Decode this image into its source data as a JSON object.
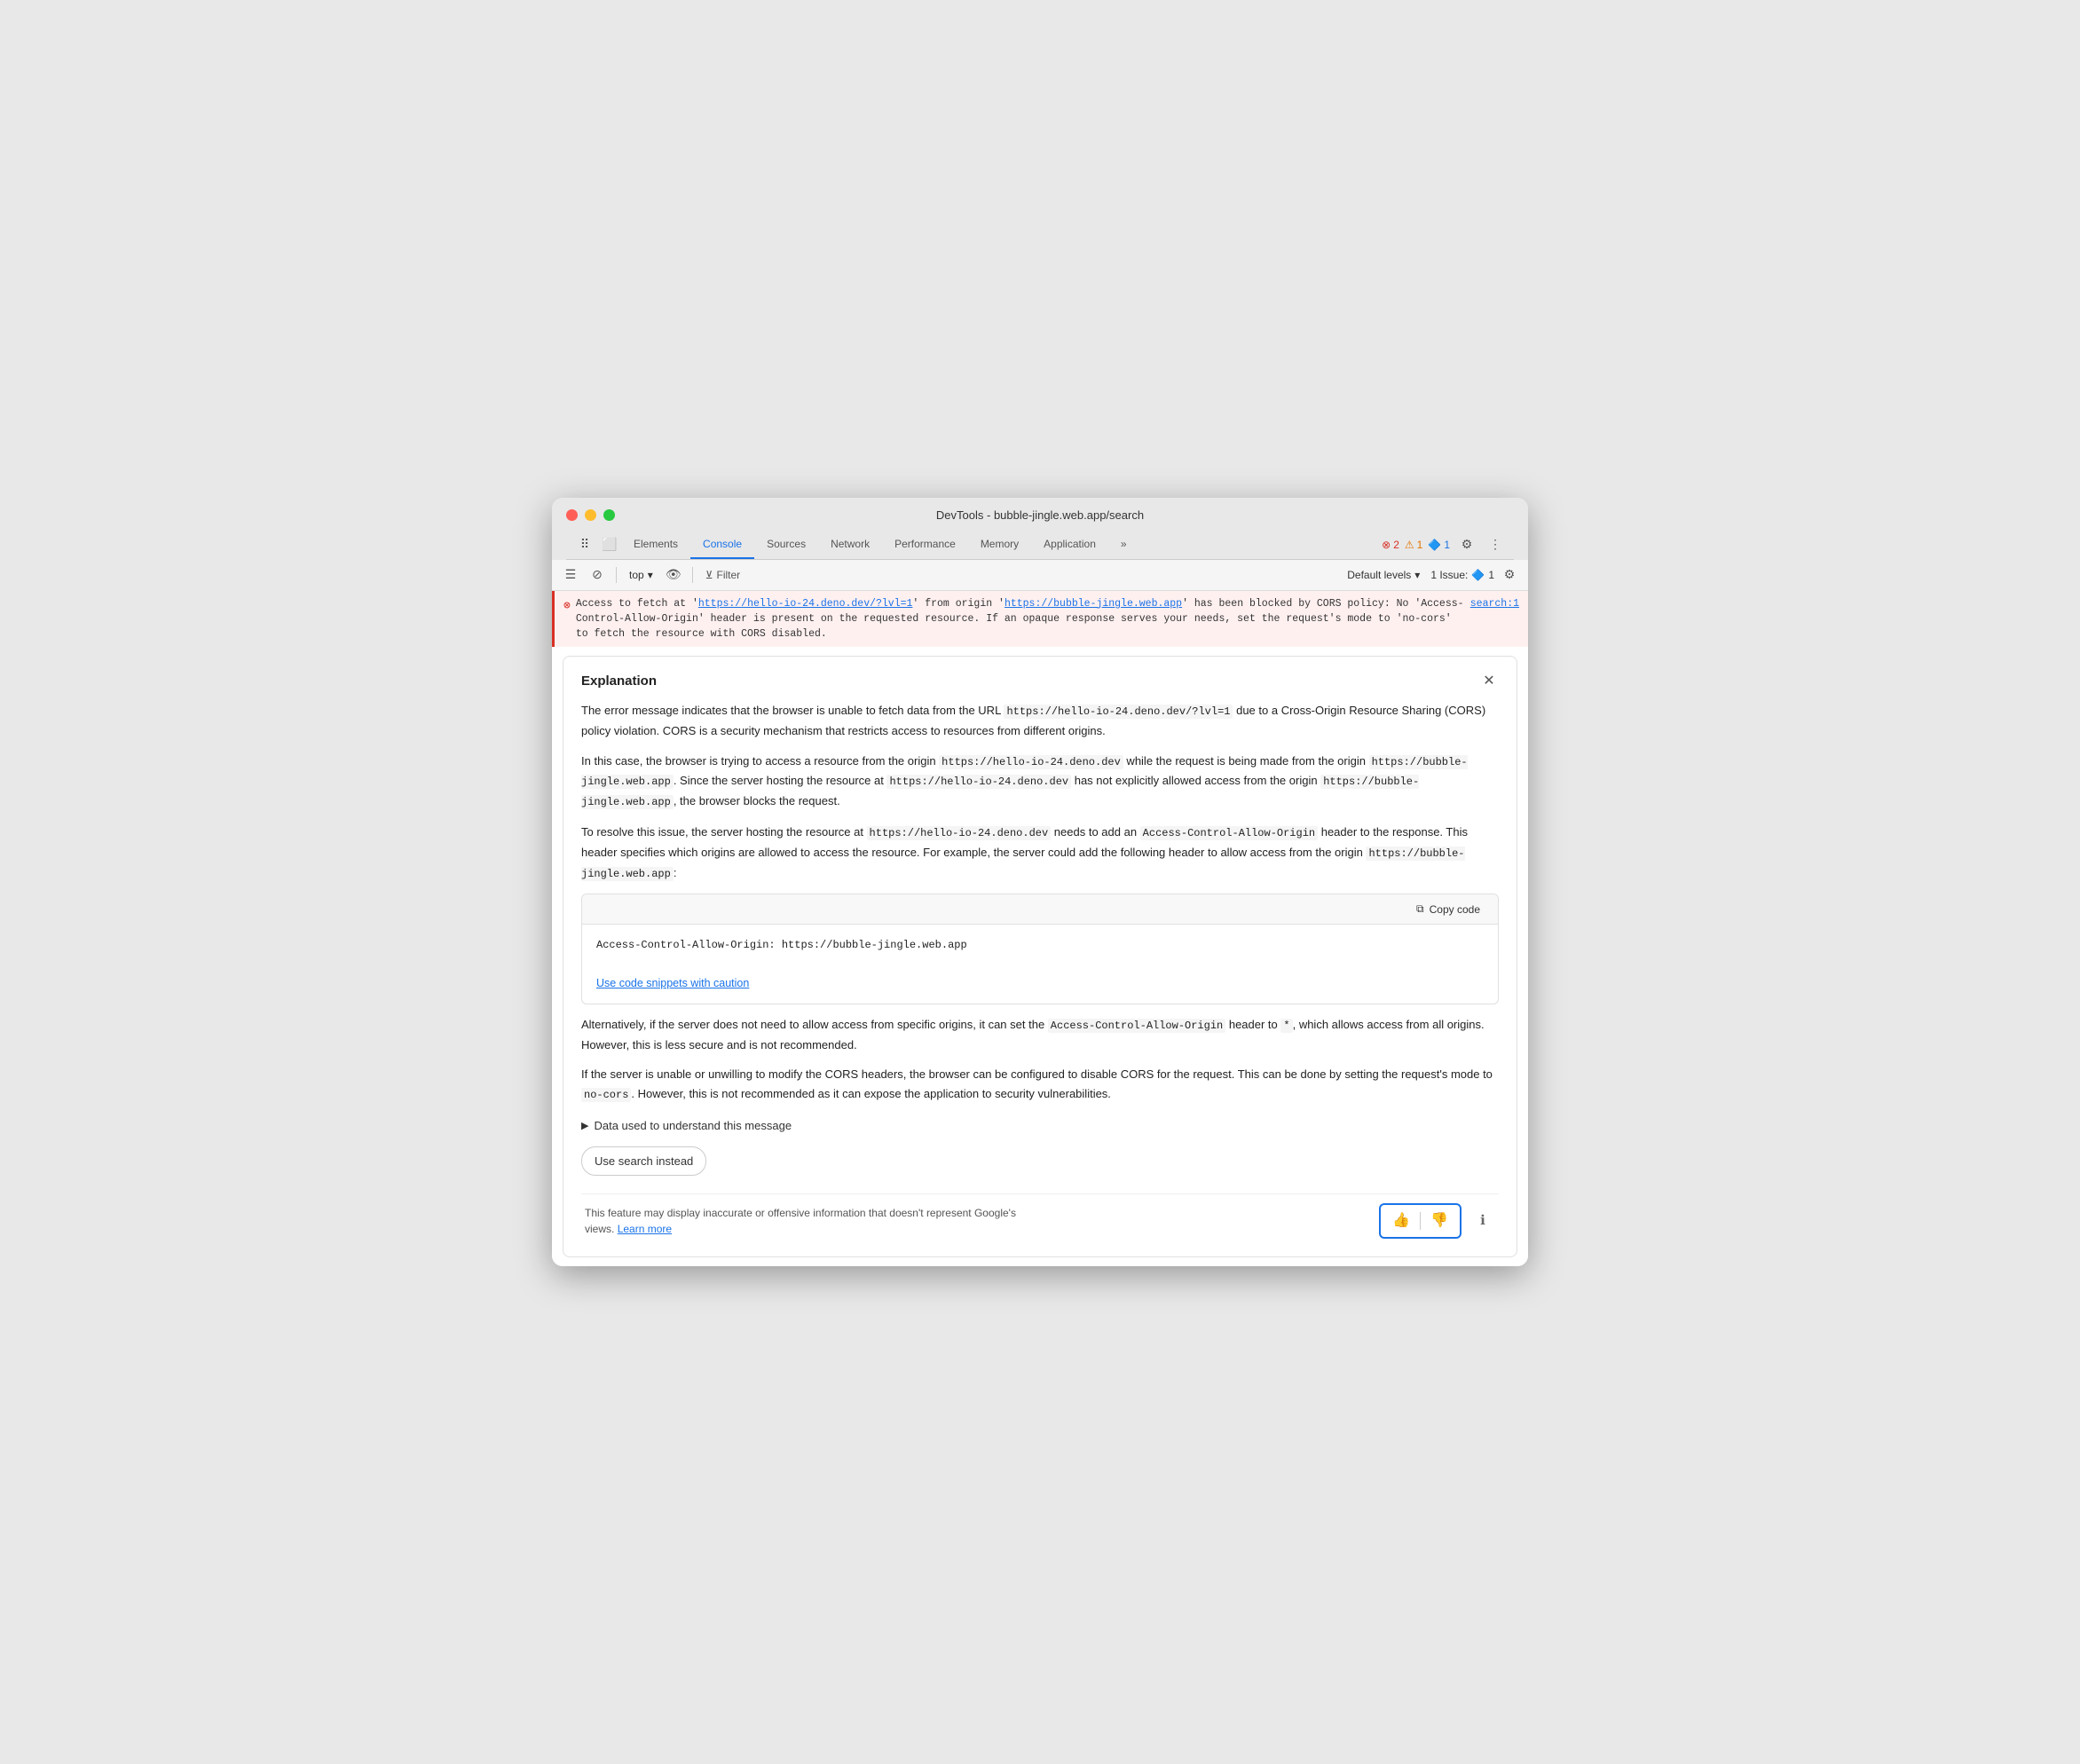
{
  "window": {
    "title": "DevTools - bubble-jingle.web.app/search"
  },
  "tabs": {
    "items": [
      {
        "label": "Elements",
        "active": false
      },
      {
        "label": "Console",
        "active": true
      },
      {
        "label": "Sources",
        "active": false
      },
      {
        "label": "Network",
        "active": false
      },
      {
        "label": "Performance",
        "active": false
      },
      {
        "label": "Memory",
        "active": false
      },
      {
        "label": "Application",
        "active": false
      }
    ],
    "more_label": "»"
  },
  "badge_errors": "2",
  "badge_warnings": "1",
  "badge_issues": "1",
  "toolbar": {
    "top_label": "top",
    "filter_label": "Filter",
    "levels_label": "Default levels",
    "issues_label": "1 Issue:"
  },
  "error": {
    "message_start": "Access to fetch at '",
    "url1": "https://hello-io-24.deno.dev/?lvl=1",
    "message_mid": "' from origin '",
    "url2": "https://bubble-jingle.web.app",
    "message_end": "' has been blocked by CORS policy: No 'Access-Control-Allow-Origin' header is present on the requested resource. If an opaque response serves your needs, set the request's mode to 'no-cors' to fetch the resource with CORS disabled.",
    "source": "search:1"
  },
  "explanation": {
    "title": "Explanation",
    "body_p1": "The error message indicates that the browser is unable to fetch data from the URL",
    "body_url1": "https://hello-io-24.deno.dev/?lvl=1",
    "body_p1_end": "due to a Cross-Origin Resource Sharing (CORS) policy violation. CORS is a security mechanism that restricts access to resources from different origins.",
    "body_p2_start": "In this case, the browser is trying to access a resource from the origin",
    "body_code1": "https://hello-io-24.deno.dev",
    "body_p2_mid": "while the request is being made from the origin",
    "body_code2": "https://bubble-jingle.web.app",
    "body_p2_mid2": ". Since the server hosting the resource at",
    "body_code3": "https://hello-io-24.deno.dev",
    "body_p2_end": "has not explicitly allowed access from the origin",
    "body_code4": "https://bubble-jingle.web.app",
    "body_p2_final": ", the browser blocks the request.",
    "body_p3_start": "To resolve this issue, the server hosting the resource at",
    "body_code5": "https://hello-io-24.deno.dev",
    "body_p3_mid": "needs to add an",
    "body_code6": "Access-Control-Allow-Origin",
    "body_p3_mid2": "header to the response. This header specifies which origins are allowed to access the resource. For example, the server could add the following header to allow access from the origin",
    "body_code7": "https://bubble-jingle.web.app",
    "body_p3_end": ":",
    "code_snippet": "Access-Control-Allow-Origin: https://bubble-jingle.web.app",
    "copy_btn": "Copy code",
    "caution_link": "Use code snippets with caution",
    "body_p4_start": "Alternatively, if the server does not need to allow access from specific origins, it can set the",
    "body_code8": "Access-Control-Allow-Origin",
    "body_p4_mid": "header to",
    "body_code9": "*",
    "body_p4_end": ", which allows access from all origins. However, this is less secure and is not recommended.",
    "body_p5_start": "If the server is unable or unwilling to modify the CORS headers, the browser can be configured to disable CORS for the request. This can be done by setting the request's mode to",
    "body_code10": "no-cors",
    "body_p5_end": ". However, this is not recommended as it can expose the application to security vulnerabilities.",
    "data_disclosure": "Data used to understand this message",
    "search_instead": "Use search instead",
    "disclaimer": "This feature may display inaccurate or offensive information that doesn't represent Google's views.",
    "learn_more": "Learn more"
  }
}
